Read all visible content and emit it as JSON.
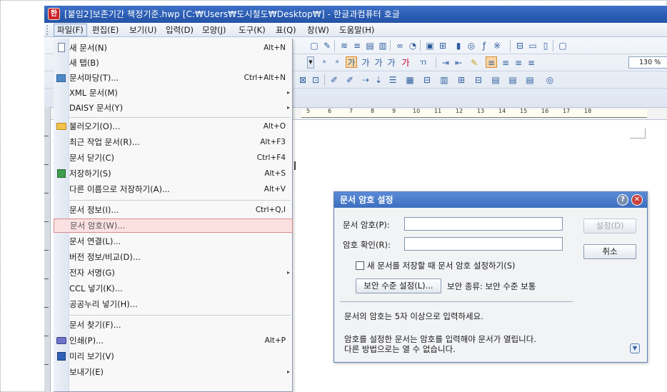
{
  "window": {
    "title": "[붙임2]보존기간 책정기준.hwp [C:₩Users₩도시철도₩Desktop₩] - 한글과컴퓨터 호글",
    "app_icon_letter": "한"
  },
  "menubar": {
    "items": [
      "파일(F)",
      "편집(E)",
      "보기(U)",
      "입력(D)",
      "모양(J)",
      "도구(K)",
      "표(Q)",
      "창(W)",
      "도움말(H)"
    ]
  },
  "toolbar": {
    "zoom": "130 %",
    "ruler_numbers": [
      "5",
      "6",
      "7",
      "8",
      "9",
      "10",
      "11",
      "12",
      "13",
      "14",
      "15",
      "16",
      "17",
      "18"
    ]
  },
  "file_menu": {
    "items": [
      {
        "label": "새 문서(N)",
        "shortcut": "Alt+N",
        "icon": "new-document-icon"
      },
      {
        "label": "새 탭(B)",
        "shortcut": "",
        "icon": ""
      },
      {
        "label": "문서마당(T)...",
        "shortcut": "Ctrl+Alt+N",
        "icon": "template-icon"
      },
      {
        "label": "XML 문서(M)",
        "shortcut": "",
        "submenu": true
      },
      {
        "label": "DAISY 문서(Y)",
        "shortcut": "",
        "submenu": true
      },
      {
        "label": "불러오기(O)...",
        "shortcut": "Alt+O",
        "icon": "open-folder-icon"
      },
      {
        "label": "최근 작업 문서(R)...",
        "shortcut": "Alt+F3"
      },
      {
        "label": "문서 닫기(C)",
        "shortcut": "Ctrl+F4"
      },
      {
        "label": "저장하기(S)",
        "shortcut": "Alt+S",
        "icon": "save-icon"
      },
      {
        "label": "다른 이름으로 저장하기(A)...",
        "shortcut": "Alt+V"
      },
      {
        "label": "문서 정보(I)...",
        "shortcut": "Ctrl+Q,I"
      },
      {
        "label": "문서 암호(W)...",
        "shortcut": "",
        "highlighted": true
      },
      {
        "label": "문서 연결(L)...",
        "shortcut": ""
      },
      {
        "label": "버전 정보/비교(D)...",
        "shortcut": ""
      },
      {
        "label": "전자 서명(G)",
        "shortcut": "",
        "submenu": true
      },
      {
        "label": "CCL 넣기(K)...",
        "shortcut": ""
      },
      {
        "label": "공공누리 넣기(H)...",
        "shortcut": ""
      },
      {
        "label": "문서 찾기(F)...",
        "shortcut": ""
      },
      {
        "label": "인쇄(P)...",
        "shortcut": "Alt+P",
        "icon": "print-icon"
      },
      {
        "label": "미리 보기(V)",
        "shortcut": "",
        "icon": "preview-icon"
      },
      {
        "label": "보내기(E)",
        "shortcut": "",
        "submenu": true
      }
    ]
  },
  "dialog": {
    "title": "문서 암호 설정",
    "password_label": "문서 암호(P):",
    "password_value": "",
    "confirm_label": "암호 확인(R):",
    "confirm_value": "",
    "set_button": "설정(D)",
    "cancel_button": "취소",
    "checkbox_label": "새 문서를 저장할 때 문서 암호 설정하기(S)",
    "checkbox_checked": false,
    "security_button": "보안 수준 설정(L)...",
    "security_type": "보안 종류: 보안 수준 보통",
    "note1": "문서의 암호는 5자 이상으로 입력하세요.",
    "note2_line1": "암호를 설정한 문서는 암호를 입력해야 문서가 열립니다.",
    "note2_line2": "다른 방법으로는 열 수 없습니다."
  }
}
